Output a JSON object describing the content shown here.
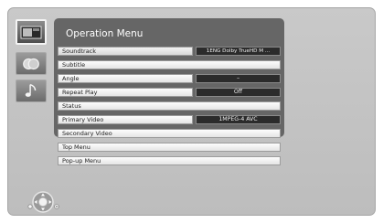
{
  "menu": {
    "title": "Operation Menu",
    "items": [
      {
        "label": "Soundtrack",
        "value": "1ENG Dolby TrueHD M ...",
        "selected": true
      },
      {
        "label": "Subtitle",
        "value": ""
      },
      {
        "label": "Angle",
        "value": "–"
      },
      {
        "label": "Repeat Play",
        "value": "Off"
      },
      {
        "label": "Status",
        "value": ""
      },
      {
        "label": "Primary Video",
        "value": "1MPEG-4 AVC"
      },
      {
        "label": "Secondary Video",
        "value": ""
      },
      {
        "label": "Top Menu",
        "value": ""
      },
      {
        "label": "Pop-up Menu",
        "value": ""
      }
    ]
  },
  "side_icons": [
    "video-icon",
    "picture-icon",
    "music-icon"
  ],
  "nav_icon": "remote-navigation-icon",
  "colors": {
    "panel": "#666666",
    "value_box": "#2b2b2b",
    "background": "#c5c5c5"
  }
}
